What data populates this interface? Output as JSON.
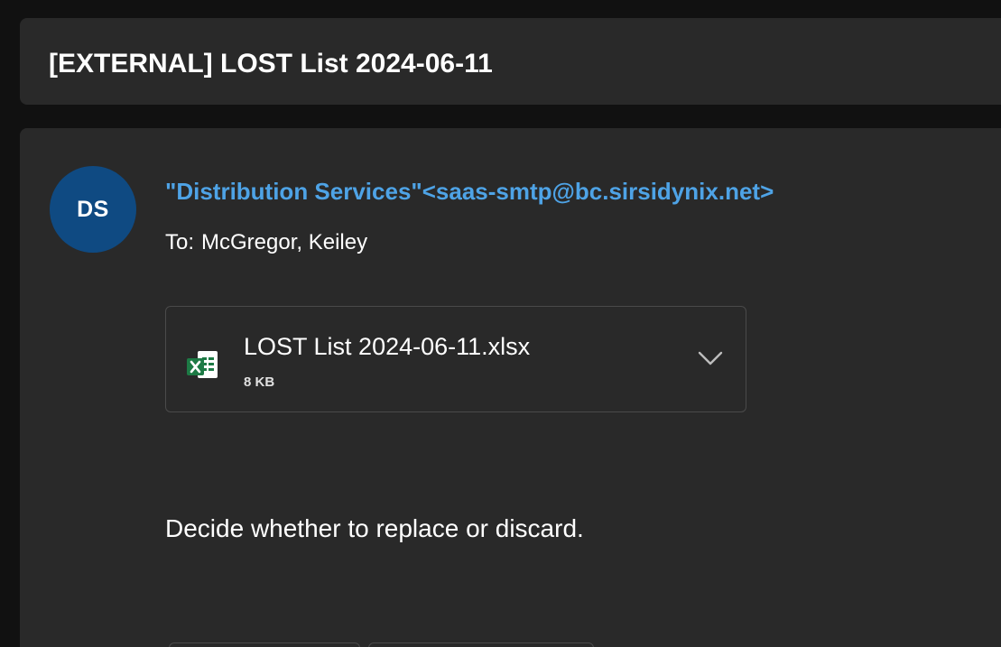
{
  "subject": "[EXTERNAL] LOST List 2024-06-11",
  "message": {
    "avatar_initials": "DS",
    "sender": "\"Distribution Services\"<saas-smtp@bc.sirsidynix.net>",
    "to_label": "To:",
    "to_name": "McGregor, Keiley",
    "attachment": {
      "file_name": "LOST List 2024-06-11.xlsx",
      "file_size": "8 KB",
      "icon": "excel-file-icon"
    },
    "body": "Decide whether to replace or discard."
  },
  "colors": {
    "background": "#111111",
    "panel": "#292929",
    "avatar": "#0f4a82",
    "sender_link": "#4ea3e6",
    "excel_green": "#1d7a45"
  }
}
